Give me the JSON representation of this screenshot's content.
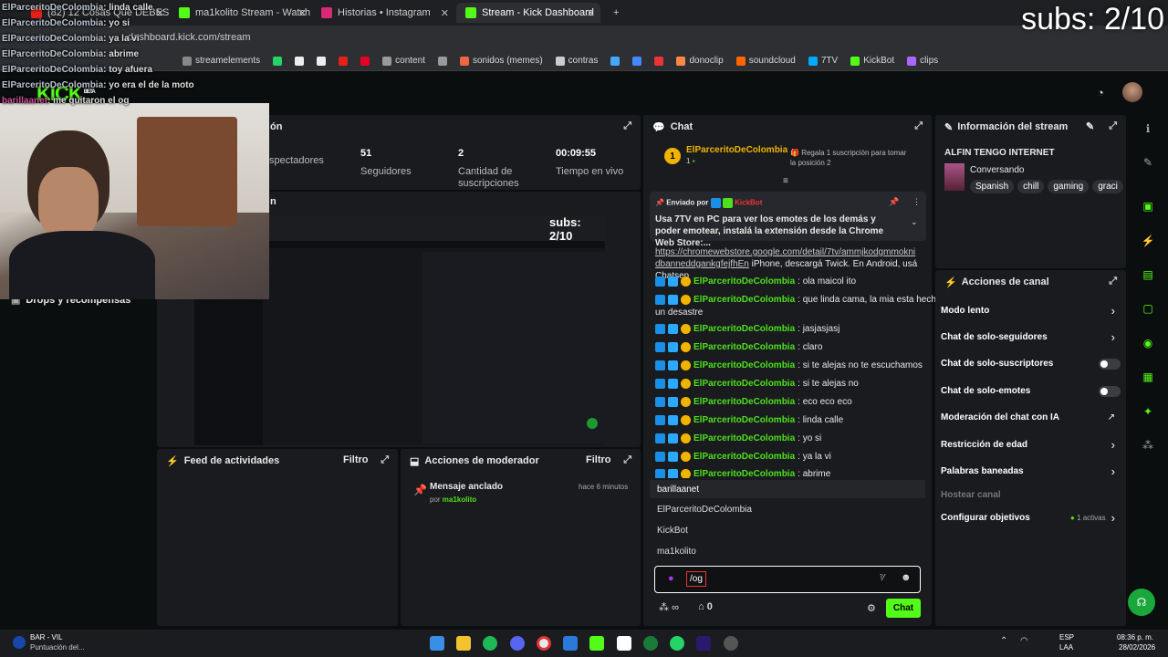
{
  "browser": {
    "tabs": [
      {
        "label": "(82) 12 Cosas Que DEBES HAC",
        "active": false
      },
      {
        "label": "ma1kolito Stream - Watch Live",
        "active": false
      },
      {
        "label": "Historias • Instagram",
        "active": false
      },
      {
        "label": "Stream - Kick Dashboard",
        "active": true
      }
    ],
    "url": "dashboard.kick.com/stream",
    "bookmarks": [
      "dashboard",
      "dashboard",
      "streamelements",
      "content",
      "sonidos (memes)",
      "contras",
      "donoclip",
      "soundcloud",
      "7TV",
      "KickBot",
      "clips"
    ]
  },
  "overlay": {
    "chat_lines": [
      {
        "user": "ElParceritoDeColombia",
        "text": ": linda calle"
      },
      {
        "user": "ElParceritoDeColombia",
        "text": ": yo si"
      },
      {
        "user": "ElParceritoDeColombia",
        "text": ": ya la vi"
      },
      {
        "user": "ElParceritoDeColombia",
        "text": ": abrime"
      },
      {
        "user": "ElParceritoDeColombia",
        "text": ": toy afuera"
      },
      {
        "user": "ElParceritoDeColombia",
        "text": ": yo era el de la moto"
      },
      {
        "user": "barillaanet",
        "text": ": me quitaron el og"
      }
    ],
    "subs": "subs: 2/10"
  },
  "kick": {
    "logo": "KICK",
    "logo_beta": "BETA"
  },
  "stream_panel": {
    "title_partial": "ón",
    "stats": [
      {
        "value": "",
        "label": "spectadores"
      },
      {
        "value": "51",
        "label": "Seguidores"
      },
      {
        "value": "2",
        "label": "Cantidad de suscripciones"
      },
      {
        "value": "00:09:55",
        "label": "Tiempo en vivo"
      }
    ],
    "preview_title_partial": "n",
    "preview_subs": "subs: 2/10"
  },
  "left_nav": {
    "drops": "Drops y recompensas"
  },
  "activity_feed": {
    "title": "Feed de actividades",
    "filter": "Filtro"
  },
  "mod_actions": {
    "title": "Acciones de moderador",
    "filter": "Filtro",
    "pinned_title": "Mensaje anclado",
    "pinned_time": "hace 6 minutos",
    "pinned_by_prefix": "por",
    "pinned_by_user": "ma1kolito"
  },
  "chat": {
    "title": "Chat",
    "top_gifter": "ElParceritoDeColombia",
    "top_gifter_count": "1",
    "top_gifter_rank": "1",
    "gift_prompt": "Regala 1 suscripción para tomar la posición 2",
    "pinned_sent_by": "Enviado por",
    "pinned_bot": "KickBot",
    "pinned_text": "Usa 7TV en PC para ver los emotes de los demás y poder emotear, instalá la extensión desde la Chrome Web Store:...",
    "link_text": "https://chromewebstore.google.com/detail/7tv/ammjkodgmmoknidbanneddgankgfejfhEn",
    "link_tail": " iPhone, descargá Twick. En Android, usá Chatsen",
    "messages": [
      {
        "user": "ElParceritoDeColombia",
        "text": ": ola maicol ito"
      },
      {
        "user": "ElParceritoDeColombia",
        "text": ": que linda cama, la mia esta hecha"
      },
      {
        "user": "",
        "text": "un desastre"
      },
      {
        "user": "ElParceritoDeColombia",
        "text": ": jasjasjasj"
      },
      {
        "user": "ElParceritoDeColombia",
        "text": ": claro"
      },
      {
        "user": "ElParceritoDeColombia",
        "text": ": si te alejas no te escuchamos"
      },
      {
        "user": "ElParceritoDeColombia",
        "text": ": si te alejas no"
      },
      {
        "user": "ElParceritoDeColombia",
        "text": ": eco eco eco"
      },
      {
        "user": "ElParceritoDeColombia",
        "text": ": linda calle"
      },
      {
        "user": "ElParceritoDeColombia",
        "text": ": yo si"
      },
      {
        "user": "ElParceritoDeColombia",
        "text": ": ya la vi"
      },
      {
        "user": "ElParceritoDeColombia",
        "text": ": abrime"
      }
    ],
    "autocomplete": [
      "barillaanet",
      "ElParceritoDeColombia",
      "KickBot",
      "ma1kolito"
    ],
    "input_value": "/og",
    "infinity_label": "∞",
    "count": "0",
    "send": "Chat"
  },
  "stream_info": {
    "title": "Información del stream",
    "stream_title": "ALFIN TENGO INTERNET",
    "category": "Conversando",
    "tags": [
      "Spanish",
      "chill",
      "gaming",
      "graci"
    ]
  },
  "channel_actions": {
    "title": "Acciones de canal",
    "items": [
      {
        "label": "Modo lento",
        "control": "chevron"
      },
      {
        "label": "Chat de solo-seguidores",
        "control": "chevron"
      },
      {
        "label": "Chat de solo-suscriptores",
        "control": "toggle"
      },
      {
        "label": "Chat de solo-emotes",
        "control": "toggle"
      },
      {
        "label": "Moderación del chat con IA",
        "control": "external"
      },
      {
        "label": "Restricción de edad",
        "control": "chevron"
      },
      {
        "label": "Palabras baneadas",
        "control": "chevron"
      },
      {
        "label": "Hostear canal",
        "control": "none"
      },
      {
        "label": "Configurar objetivos",
        "control": "chevron"
      }
    ],
    "goals_active": "1 activas"
  },
  "taskbar": {
    "widget_title": "BAR - VIL",
    "widget_sub": "Puntuación del...",
    "lang": "ESP",
    "lang_sub": "LAA",
    "time": "08:36 p. m.",
    "date": "28/02/2026"
  },
  "colors": {
    "kick_green": "#53fc18",
    "user_green": "#4ee01c",
    "bg": "#0b0e0f",
    "panel": "#191b1f"
  }
}
